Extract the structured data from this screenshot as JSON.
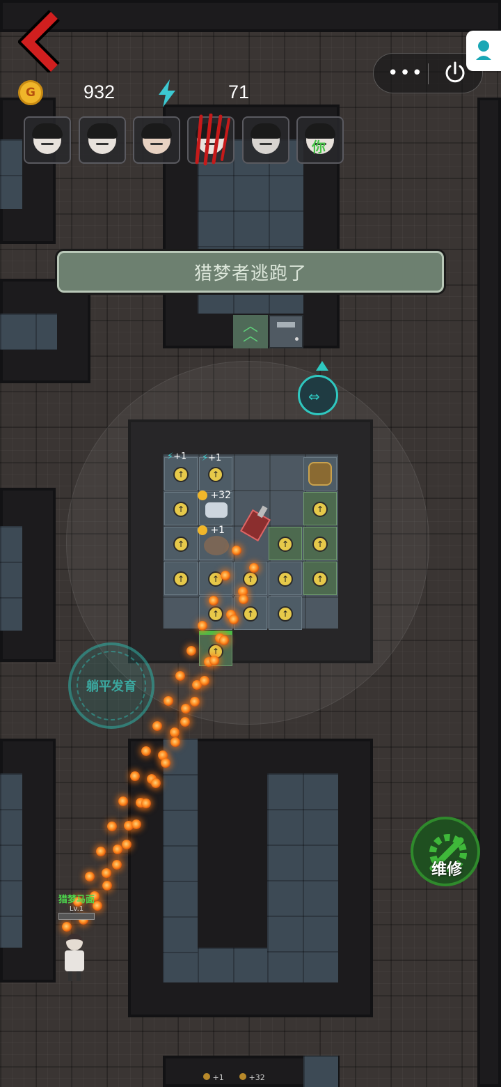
{
  "hud": {
    "coin_icon": "coin-icon",
    "gold": "932",
    "energy_icon": "lightning-icon",
    "energy": "71"
  },
  "players": [
    {
      "name": "player-portrait-1"
    },
    {
      "name": "player-portrait-2"
    },
    {
      "name": "player-portrait-3"
    },
    {
      "name": "player-portrait-4"
    },
    {
      "name": "player-portrait-5"
    },
    {
      "name": "player-portrait-self",
      "label": "你"
    }
  ],
  "banner": {
    "message": "猎梦者逃跑了"
  },
  "stamp": {
    "text": "躺平发育"
  },
  "repair": {
    "label": "维修"
  },
  "hunter": {
    "name": "猎梦马面",
    "level": "Lv.1"
  },
  "floaters": [
    {
      "text": "+1"
    },
    {
      "text": "+1"
    },
    {
      "text": "+32"
    },
    {
      "text": "+1"
    }
  ],
  "bottom": {
    "left": "+1",
    "right": "+32"
  },
  "colors": {
    "back_arrow": "#d11f1f",
    "accent_cyan": "#2fc8c0",
    "repair_green": "#3fb83a",
    "banner_bg": "#6d8070",
    "hunter_name": "#4ddc4d"
  }
}
